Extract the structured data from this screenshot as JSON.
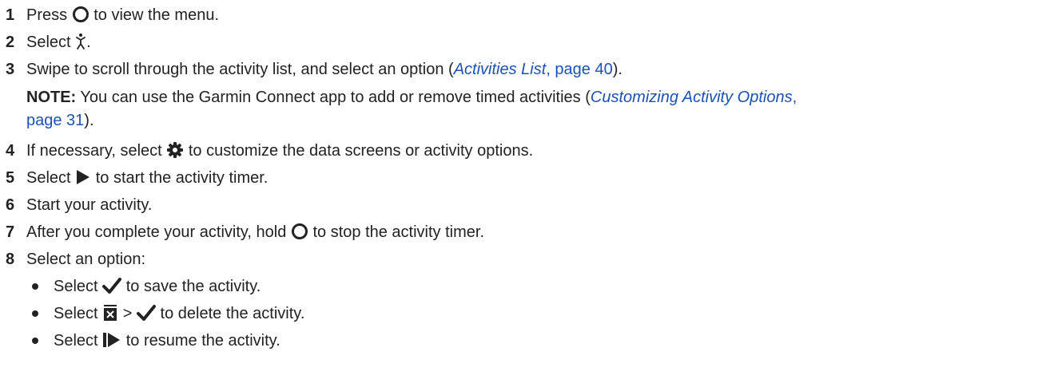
{
  "steps": [
    {
      "num": "1",
      "pre": "Press",
      "post": "to view the menu."
    },
    {
      "num": "2",
      "pre": "Select",
      "post": "."
    },
    {
      "num": "3",
      "text": "Swipe to scroll through the activity list, and select an option (",
      "link_title": "Activities List",
      "link_page": ", page 40",
      "close": ")."
    },
    {
      "num": "4",
      "pre": "If necessary, select",
      "post": "to customize the data screens or activity options."
    },
    {
      "num": "5",
      "pre": "Select",
      "post": "to start the activity timer."
    },
    {
      "num": "6",
      "text": "Start your activity."
    },
    {
      "num": "7",
      "pre": "After you complete your activity, hold",
      "post": "to stop the activity timer."
    },
    {
      "num": "8",
      "text": "Select an option:"
    }
  ],
  "note": {
    "label": "NOTE:",
    "text": " You can use the Garmin Connect app to add or remove timed activities (",
    "link_title": "Customizing Activity Options",
    "link_page_a": ",",
    "link_page_b": "page 31",
    "close": ")."
  },
  "options": [
    {
      "pre": "Select",
      "post": "to save the activity."
    },
    {
      "pre": "Select",
      "mid": ">",
      "post": "to delete the activity."
    },
    {
      "pre": "Select",
      "post": "to resume the activity."
    }
  ],
  "icons": {
    "button": "circle-button-icon",
    "activity": "running-figure-icon",
    "settings": "gear-icon",
    "start": "play-icon",
    "save": "checkmark-icon",
    "discard": "discard-icon",
    "resume": "resume-icon"
  },
  "colors": {
    "text": "#222222",
    "link": "#1a52b5"
  }
}
